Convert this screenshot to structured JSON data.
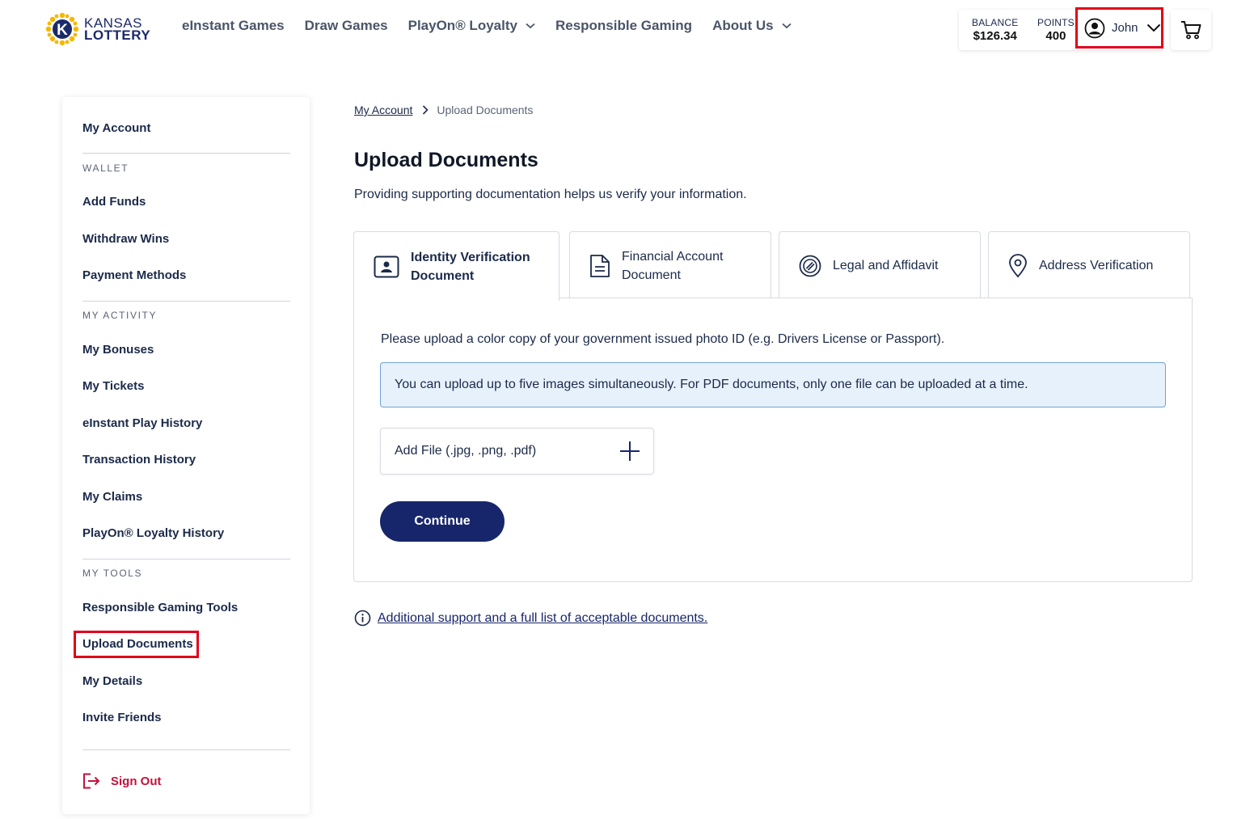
{
  "header": {
    "logo": {
      "line1": "KANSAS",
      "line2": "LOTTERY"
    },
    "nav": [
      {
        "label": "eInstant Games",
        "dropdown": false
      },
      {
        "label": "Draw Games",
        "dropdown": false
      },
      {
        "label": "PlayOn® Loyalty",
        "dropdown": true
      },
      {
        "label": "Responsible Gaming",
        "dropdown": false
      },
      {
        "label": "About Us",
        "dropdown": true
      }
    ],
    "balance": {
      "label": "BALANCE",
      "value": "$126.34"
    },
    "points": {
      "label": "POINTS",
      "value": "400"
    },
    "user": {
      "name": "John"
    }
  },
  "sidebar": {
    "my_account": "My Account",
    "wallet": {
      "title": "WALLET",
      "items": [
        "Add Funds",
        "Withdraw Wins",
        "Payment Methods"
      ]
    },
    "activity": {
      "title": "MY ACTIVITY",
      "items": [
        "My Bonuses",
        "My Tickets",
        "eInstant Play History",
        "Transaction History",
        "My Claims",
        "PlayOn® Loyalty History"
      ]
    },
    "tools": {
      "title": "MY TOOLS",
      "items": [
        "Responsible Gaming Tools",
        "Upload Documents",
        "My Details",
        "Invite Friends"
      ]
    },
    "sign_out": "Sign Out"
  },
  "main": {
    "breadcrumb": {
      "parent": "My Account",
      "current": "Upload Documents"
    },
    "title": "Upload Documents",
    "description": "Providing supporting documentation helps us verify your information.",
    "tabs": [
      {
        "label": "Identity Verification Document",
        "icon": "id-card-icon",
        "active": true
      },
      {
        "label": "Financial Account Document",
        "icon": "document-icon",
        "active": false
      },
      {
        "label": "Legal and Affidavit",
        "icon": "legal-seal-icon",
        "active": false
      },
      {
        "label": "Address Verification",
        "icon": "location-pin-icon",
        "active": false
      }
    ],
    "instruction": "Please upload a color copy of your government issued photo ID (e.g. Drivers License or Passport).",
    "info": "You can upload up to five images simultaneously. For PDF documents, only one file can be uploaded at a time.",
    "add_file": "Add File (.jpg, .png, .pdf)",
    "continue": "Continue",
    "support_link": "Additional support and a full list of acceptable documents."
  },
  "colors": {
    "primary": "#17266a",
    "highlight": "#e0001b",
    "sign_out": "#c4123b",
    "info_bg": "#e7f1fb",
    "info_border": "#6fa3d8"
  }
}
